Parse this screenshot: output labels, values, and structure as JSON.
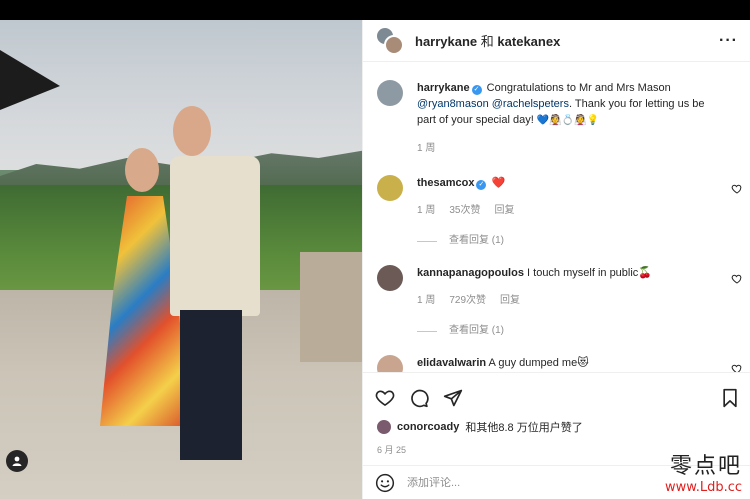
{
  "header": {
    "user1": "harrykane",
    "joiner": "和",
    "user2": "katekanex",
    "more": "···"
  },
  "caption": {
    "username": "harrykane",
    "text_before": "Congratulations to Mr and Mrs Mason",
    "mention1": "@ryan8mason",
    "mention2": "@rachelspeters",
    "text_after": ". Thank you for letting us be part of your special day!",
    "emojis": "💙👰💍👰💡",
    "time": "1 周"
  },
  "comments": [
    {
      "username": "thesamcox",
      "verified": true,
      "text": "❤️",
      "time": "1 周",
      "likes": "35次赞",
      "reply": "回复",
      "view_replies": "查看回复 (1)"
    },
    {
      "username": "kannapanagopoulos",
      "verified": false,
      "text": "I touch myself in public🍒",
      "time": "1 周",
      "likes": "729次赞",
      "reply": "回复",
      "view_replies": "查看回复 (1)"
    },
    {
      "username": "elidavalwarin",
      "verified": false,
      "text": "A guy dumped me😻"
    }
  ],
  "likes": {
    "user": "conorcoady",
    "text": "和其他8.8 万位用户赞了"
  },
  "date": "6 月 25",
  "add_comment": {
    "placeholder": "添加评论..."
  },
  "watermark": {
    "line1": "零点吧",
    "line2": "www.Ldb.cc"
  },
  "colors": {
    "verified": "#3897f0",
    "mention": "#00376b",
    "muted": "#8e8e8e",
    "heart": "#ed4956"
  },
  "icons": [
    "heart-icon",
    "comment-icon",
    "share-icon",
    "bookmark-icon",
    "emoji-icon",
    "user-tag-icon",
    "more-icon"
  ]
}
